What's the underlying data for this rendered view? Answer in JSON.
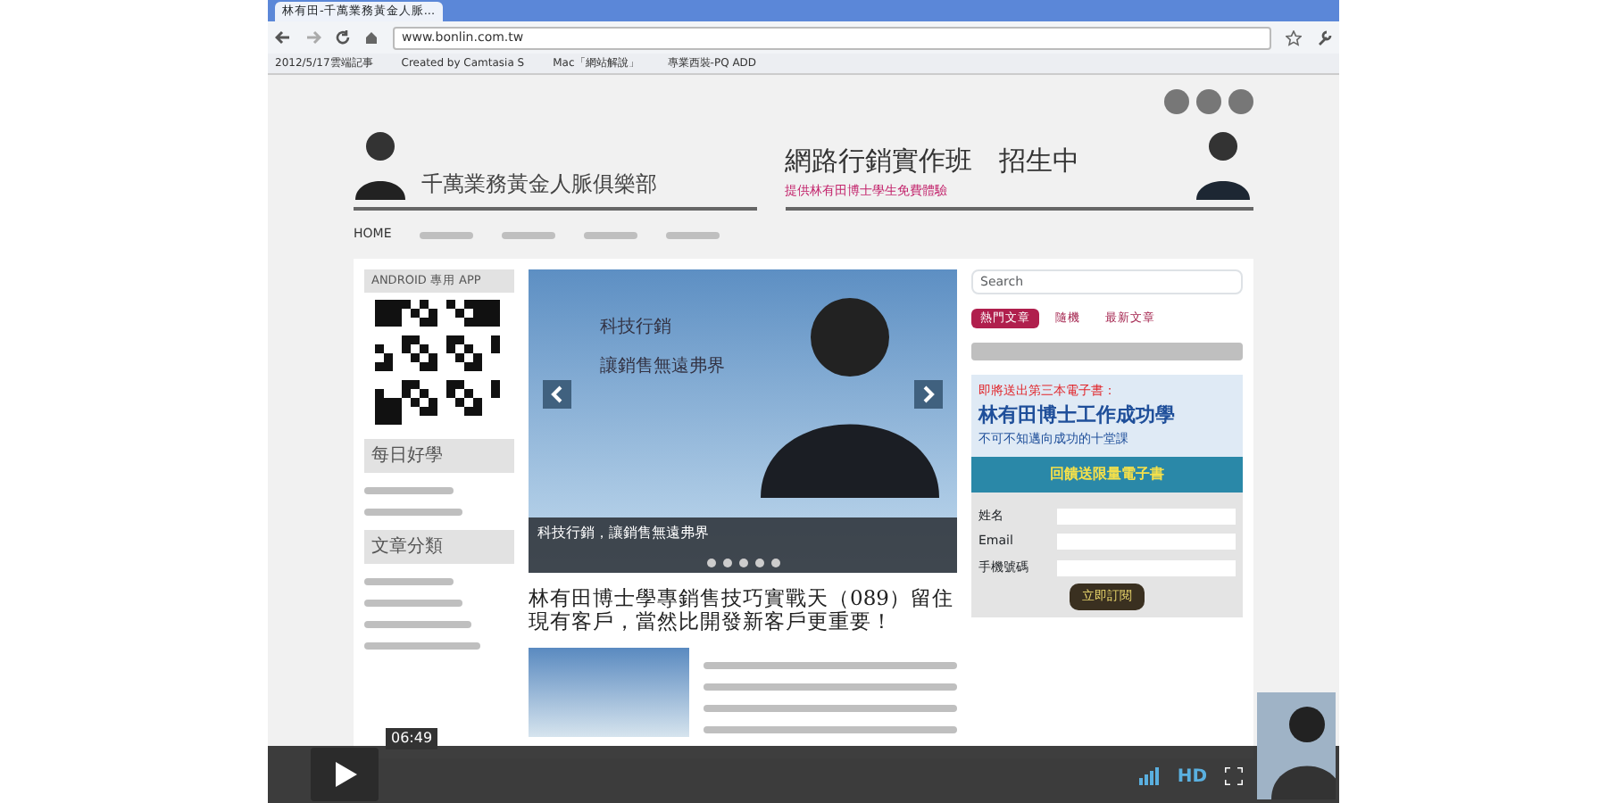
{
  "browser": {
    "tab_title": "林有田-千萬業務黃金人脈...",
    "url": "www.bonlin.com.tw",
    "bookmarks": [
      "2012/5/17雲端記事",
      "Created by Camtasia S",
      "Mac「網站解說」",
      "專業西裝-PQ ADD"
    ]
  },
  "site": {
    "title": "千萬業務黃金人脈俱樂部",
    "banner_title": "網路行銷實作班　招生中",
    "banner_subtitle": "提供林有田博士學生免費體驗",
    "nav": [
      {
        "label": "HOME",
        "selected": true
      }
    ],
    "app_heading": "ANDROID 專用 APP",
    "widget_headings": [
      "每日好學",
      "文章分類"
    ],
    "slider": {
      "line1": "科技行銷",
      "line2": "讓銷售無遠弗界",
      "caption": "科技行銷，讓銷售無遠弗界"
    },
    "post_title": "林有田博士學專銷售技巧實戰天（089）留住現有客戶，當然比開發新客戶更重要！",
    "search_placeholder": "Search",
    "tabs": [
      {
        "label": "熱門文章",
        "selected": true
      },
      {
        "label": "隨機",
        "selected": false
      },
      {
        "label": "最新文章",
        "selected": false
      }
    ],
    "ebook": {
      "kicker": "即將送出第三本電子書：",
      "title": "林有田博士工作成功學",
      "subtitle": "不可不知邁向成功的十堂課",
      "gift": "回饋送限量電子書"
    },
    "form": {
      "fields": [
        "姓名",
        "Email",
        "手機號碼"
      ],
      "submit": "立即訂閱"
    }
  },
  "video": {
    "time": "06:49",
    "hd": "HD"
  }
}
